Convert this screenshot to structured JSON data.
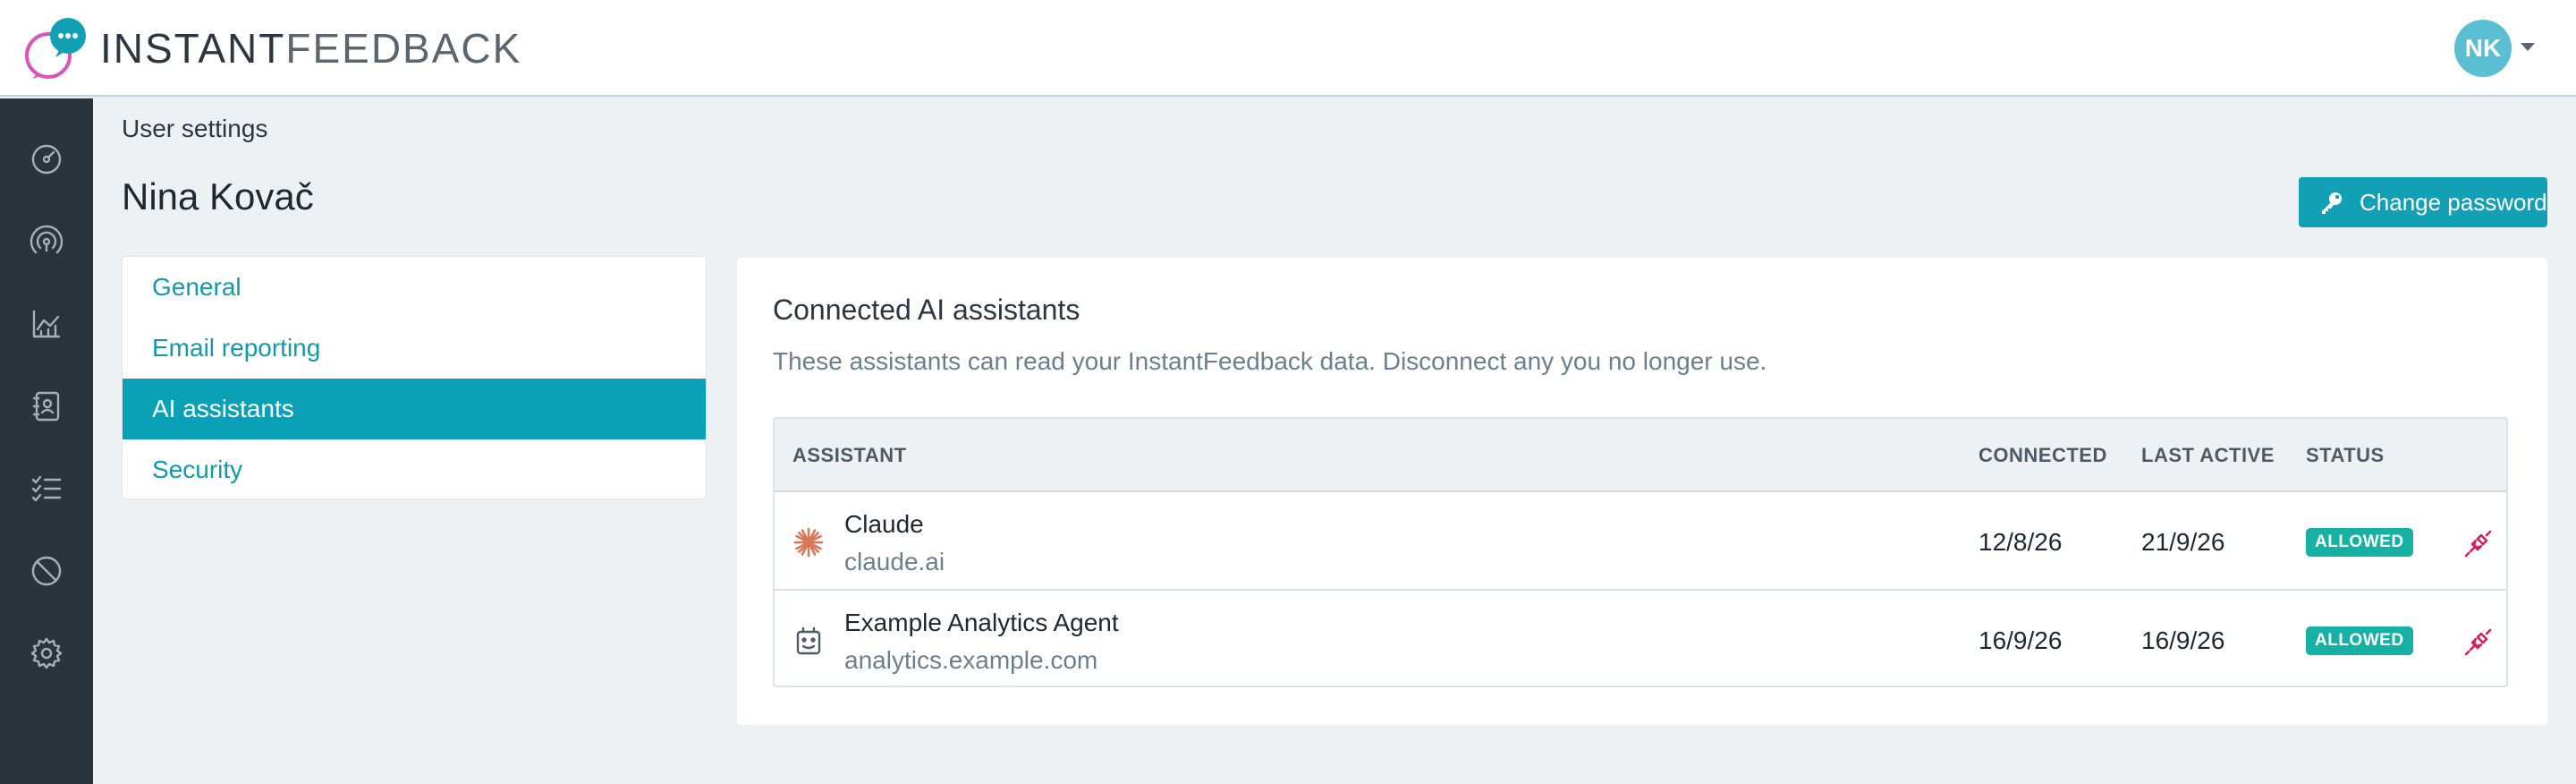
{
  "app": {
    "logo_bold": "INSTANT",
    "logo_light": "FEEDBACK",
    "user_initials": "NK",
    "accent_color": "#12a0b5"
  },
  "sidebar": {
    "items": [
      {
        "icon": "dashboard-gauge-icon"
      },
      {
        "icon": "broadcast-icon"
      },
      {
        "icon": "analytics-chart-icon"
      },
      {
        "icon": "contacts-book-icon"
      },
      {
        "icon": "checklist-icon"
      },
      {
        "icon": "block-icon"
      },
      {
        "icon": "gear-icon"
      }
    ]
  },
  "header": {
    "breadcrumb": "User settings",
    "title": "Nina Kovač",
    "change_password_label": "Change password"
  },
  "menu": {
    "items": [
      {
        "label": "General",
        "active": false
      },
      {
        "label": "Email reporting",
        "active": false
      },
      {
        "label": "AI assistants",
        "active": true
      },
      {
        "label": "Security",
        "active": false
      }
    ]
  },
  "panel": {
    "title": "Connected AI assistants",
    "description": "These assistants can read your InstantFeedback data. Disconnect any you no longer use.",
    "columns": [
      "ASSISTANT",
      "CONNECTED",
      "LAST ACTIVE",
      "STATUS"
    ],
    "rows": [
      {
        "name": "Claude",
        "domain": "claude.ai",
        "connected": "12/8/26",
        "last_active": "21/9/26",
        "status": "ALLOWED",
        "icon": "claude-sunburst-icon"
      },
      {
        "name": "Example Analytics Agent",
        "domain": "analytics.example.com",
        "connected": "16/9/26",
        "last_active": "16/9/26",
        "status": "ALLOWED",
        "icon": "robot-icon"
      }
    ]
  }
}
